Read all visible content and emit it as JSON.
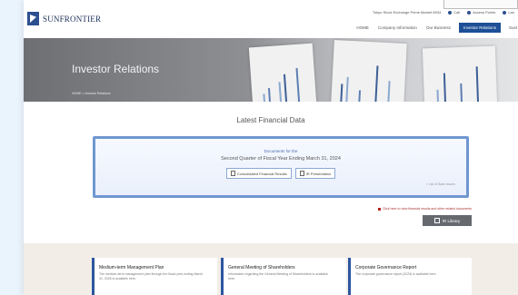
{
  "header": {
    "logo_text": "SUNFRONTIER",
    "utility": [
      {
        "label": "Tokyo Stock Exchange Prime Market 8934"
      },
      {
        "label": "Call"
      },
      {
        "label": "Access Points"
      },
      {
        "label": "Lan"
      }
    ],
    "nav": [
      {
        "label": "HOME",
        "active": false
      },
      {
        "label": "Company Information",
        "active": false
      },
      {
        "label": "Our Business",
        "active": false
      },
      {
        "label": "Investor Relations",
        "active": true
      },
      {
        "label": "Sust",
        "active": false
      }
    ]
  },
  "hero": {
    "title": "Investor Relations",
    "breadcrumb": "HOME > Investor Relations"
  },
  "latest": {
    "section_title": "Latest Financial Data",
    "lead": "Documents for the",
    "title": "Second Quarter of Fiscal Year Ending March 31, 2024",
    "buttons": [
      {
        "label": "Consolidated Financial Results"
      },
      {
        "label": "IR Presentation"
      }
    ],
    "more": "> List of Back Issues"
  },
  "notice": "Click here to view financial results and other related documents",
  "ir_library": {
    "label": "IR Library"
  },
  "cards": [
    {
      "title": "Medium-term Management Plan",
      "desc": "The medium-term management plan through the fiscal year ending March 31, 2026 is available here."
    },
    {
      "title": "General Meeting of Shareholders",
      "desc": "Information regarding the General Meeting of Shareholders is available here."
    },
    {
      "title": "Corporate Governance Report",
      "desc": "The corporate governance report (2023) is available here."
    }
  ],
  "colors": {
    "brand_navy": "#1c2f5a",
    "nav_active": "#1d4f96",
    "card_border": "#6f97cf",
    "accent_blue": "#2c56a0"
  }
}
